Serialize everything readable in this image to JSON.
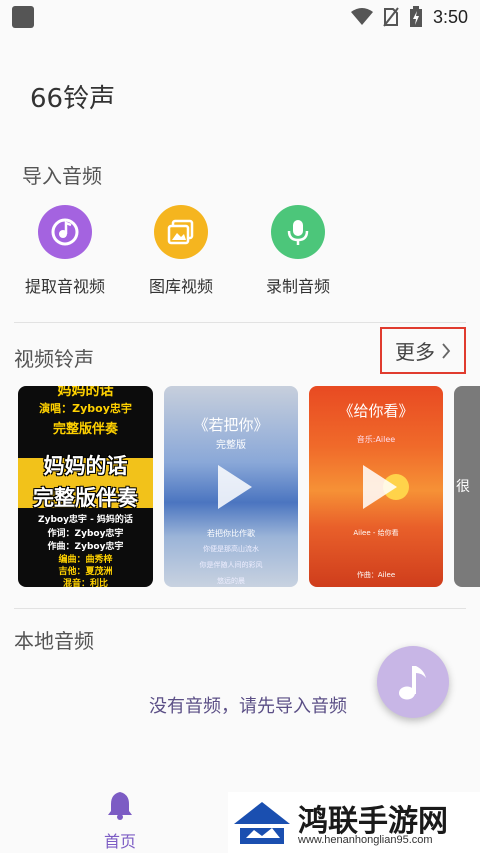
{
  "status_bar": {
    "time": "3:50"
  },
  "app": {
    "title": "66铃声"
  },
  "import_section": {
    "title": "导入音频",
    "items": [
      {
        "label": "提取音视频",
        "icon": "extract-audio-video-icon",
        "color": "#a463e0"
      },
      {
        "label": "图库视频",
        "icon": "gallery-video-icon",
        "color": "#f5b51f"
      },
      {
        "label": "录制音频",
        "icon": "microphone-icon",
        "color": "#4cc67a"
      }
    ]
  },
  "video_section": {
    "title": "视频铃声",
    "more_label": "更多"
  },
  "video_cards": [
    {
      "top_text": "妈妈的话",
      "singer_line": "演唱：Zyboy忠宇",
      "sub_title": "完整版伴奏",
      "big_line1": "妈妈的话",
      "big_line2": "完整版伴奏",
      "credit1": "Zyboy忠宇 - 妈妈的话",
      "credit2": "作词：Zyboy忠宇",
      "credit3": "作曲：Zyboy忠宇",
      "credit4": "编曲：曲秀梓",
      "credit5": "吉他：夏茂洲",
      "credit6": "混音：利比"
    },
    {
      "title": "《若把你》",
      "subtitle": "完整版",
      "lyric1": "若把你比作歌",
      "lyric2": "你便是那高山流水",
      "lyric3": "你是伴随人间的彩风",
      "lyric4": "悠远的晨"
    },
    {
      "title": "《给你看》",
      "singer": "音乐:Ailee",
      "line1": "Ailee - 给你看",
      "line2": "作曲：Ailee"
    },
    {
      "side_text": "很"
    }
  ],
  "local_section": {
    "title": "本地音频",
    "empty_text": "没有音频，请先导入音频"
  },
  "bottom_nav": {
    "home_label": "首页"
  },
  "watermark": {
    "text": "鸿联手游网",
    "url": "www.henanhonglian95.com"
  }
}
